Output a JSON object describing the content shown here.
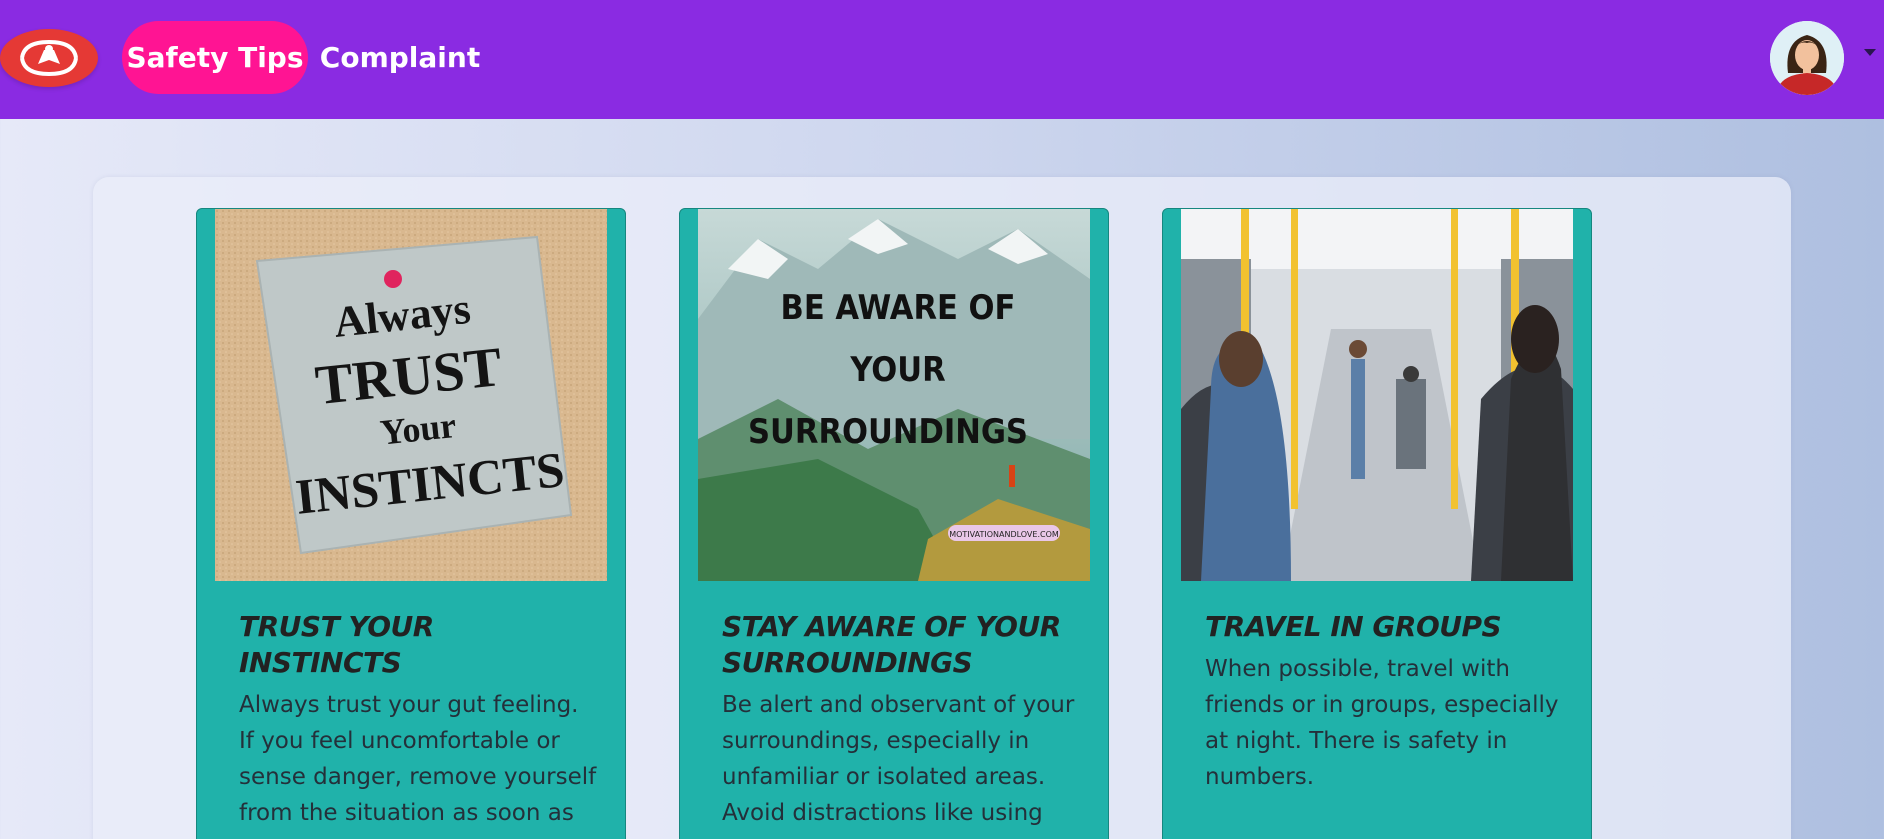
{
  "nav": {
    "logo_icon": "shield-logo-icon",
    "links": [
      {
        "label": "Safety Tips",
        "active": true
      },
      {
        "label": "Complaint",
        "active": false
      }
    ],
    "avatar_icon": "user-avatar-icon",
    "menu_icon": "caret-down-icon"
  },
  "colors": {
    "navbar": "#8a2be2",
    "active_link": "#ff1493",
    "card": "#20b2aa"
  },
  "cards": [
    {
      "title": "TRUST YOUR INSTINCTS",
      "text": "Always trust your gut feeling. If you feel uncomfortable or sense danger, remove yourself from the situation as soon as",
      "image": {
        "lines": [
          "Always",
          "TRUST",
          "Your",
          "INSTINCTS"
        ]
      }
    },
    {
      "title": "STAY AWARE OF YOUR SURROUNDINGS",
      "text": "Be alert and observant of your surroundings, especially in unfamiliar or isolated areas. Avoid distractions like using",
      "image": {
        "lines": [
          "BE AWARE OF",
          "YOUR",
          "SURROUNDINGS"
        ],
        "badge": "MOTIVATIONANDLOVE.COM"
      }
    },
    {
      "title": "TRAVEL IN GROUPS",
      "text": "When possible, travel with friends or in groups, especially at night. There is safety in numbers.",
      "image": {
        "lines": []
      }
    }
  ]
}
